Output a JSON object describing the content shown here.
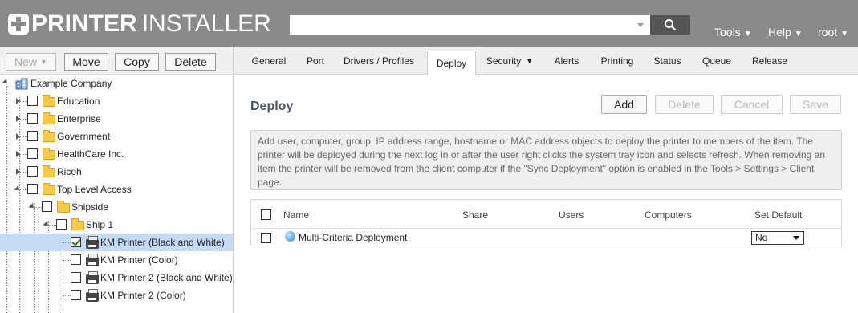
{
  "header": {
    "logo_bold": "PRINTER",
    "logo_light": "INSTALLER",
    "search": {
      "value": "",
      "placeholder": ""
    },
    "menus": [
      {
        "label": "Tools"
      },
      {
        "label": "Help"
      },
      {
        "label": "root"
      }
    ]
  },
  "left_toolbar": {
    "new_label": "New",
    "move_label": "Move",
    "copy_label": "Copy",
    "delete_label": "Delete"
  },
  "tree": {
    "root": "Example Company",
    "items": [
      {
        "label": "Education",
        "checked": false
      },
      {
        "label": "Enterprise",
        "checked": false
      },
      {
        "label": "Government",
        "checked": false
      },
      {
        "label": "HealthCare Inc.",
        "checked": false
      },
      {
        "label": "Ricoh",
        "checked": false
      },
      {
        "label": "Top Level Access",
        "checked": false
      },
      {
        "label": "Shipside",
        "checked": false
      },
      {
        "label": "Ship 1",
        "checked": false
      },
      {
        "label": "KM Printer (Black and White)",
        "checked": true,
        "selected": true
      },
      {
        "label": "KM Printer (Color)",
        "checked": false
      },
      {
        "label": "KM Printer 2 (Black and White)",
        "checked": false
      },
      {
        "label": "KM Printer 2 (Color)",
        "checked": false
      }
    ]
  },
  "tabs": [
    {
      "label": "General"
    },
    {
      "label": "Port"
    },
    {
      "label": "Drivers / Profiles"
    },
    {
      "label": "Deploy",
      "active": true
    },
    {
      "label": "Security"
    },
    {
      "label": "Alerts"
    },
    {
      "label": "Printing"
    },
    {
      "label": "Status"
    },
    {
      "label": "Queue"
    },
    {
      "label": "Release"
    }
  ],
  "deploy": {
    "title": "Deploy",
    "buttons": {
      "add": "Add",
      "delete": "Delete",
      "cancel": "Cancel",
      "save": "Save"
    },
    "info_text": "Add user, computer, group, IP address range, hostname or MAC address objects to deploy the printer to members of the item. The printer will be deployed during the next log in or after the user right clicks the system tray icon and selects refresh. When removing an item the printer will be removed from the client computer if the \"Sync Deployment\" option is enabled in the Tools > Settings > Client page.",
    "columns": {
      "name": "Name",
      "share": "Share",
      "users": "Users",
      "computers": "Computers",
      "set_default": "Set Default"
    },
    "rows": [
      {
        "name": "Multi-Criteria Deployment",
        "set_default": "No"
      }
    ]
  },
  "colors": {
    "header_bg": "#8a8a8a",
    "search_button": "#555555",
    "selected_row": "#c5daf5",
    "title_color": "#4a5568"
  },
  "icons": [
    "plus-logo-icon",
    "search-icon",
    "folder-icon",
    "printer-icon",
    "company-icon",
    "globe-icon"
  ]
}
